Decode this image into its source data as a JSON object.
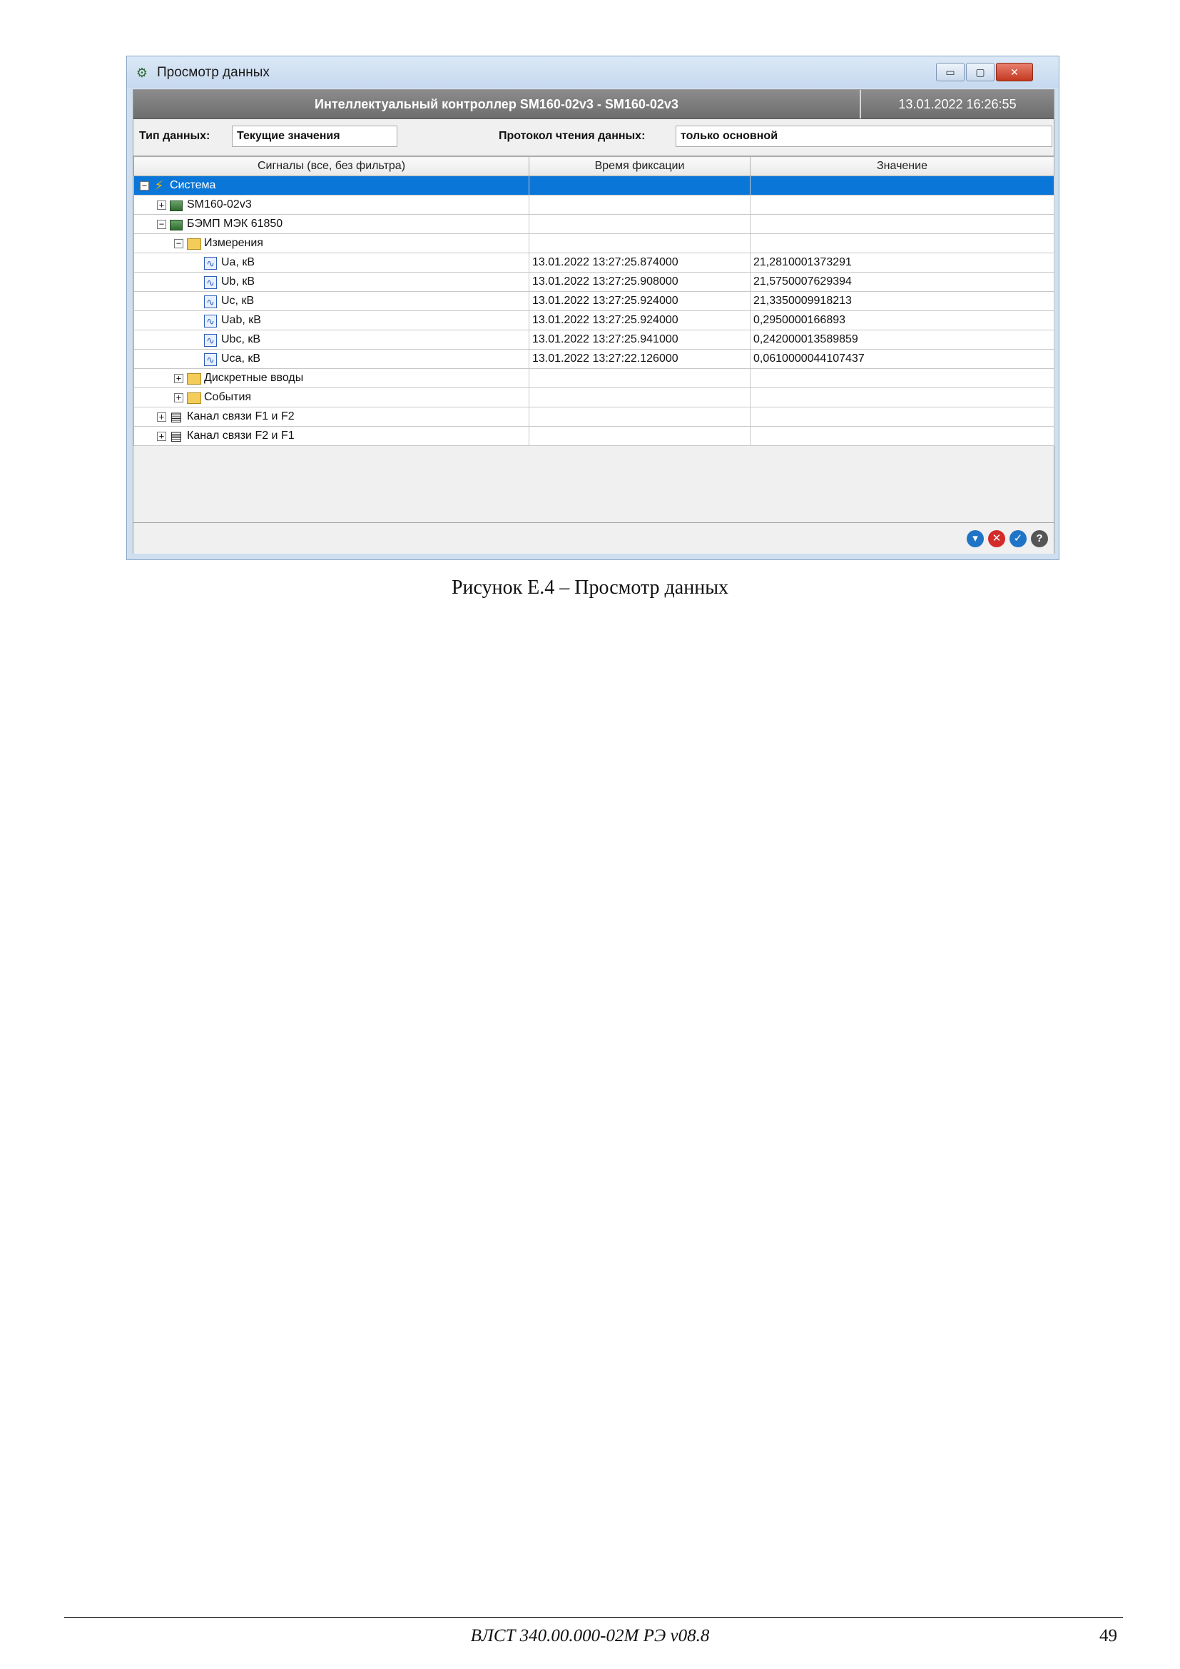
{
  "window": {
    "title": "Просмотр данных",
    "controls": {
      "minimize": "▭",
      "maximize": "▢",
      "close": "✕"
    }
  },
  "header": {
    "title": "Интеллектуальный контроллер SM160-02v3 - SM160-02v3",
    "datetime": "13.01.2022 16:26:55"
  },
  "filters": {
    "data_type_label": "Тип данных:",
    "data_type_value": "Текущие значения",
    "protocol_label": "Протокол чтения данных:",
    "protocol_value": "только основной"
  },
  "grid": {
    "columns": [
      "Сигналы (все, без фильтра)",
      "Время фиксации",
      "Значение"
    ],
    "rows": [
      {
        "name": "Система",
        "icon": "lightning-icon",
        "toggle": "−",
        "time": "",
        "value": ""
      },
      {
        "name": "SM160-02v3",
        "icon": "device-icon",
        "toggle": "+",
        "time": "",
        "value": ""
      },
      {
        "name": "БЭМП МЭК 61850",
        "icon": "device-icon",
        "toggle": "−",
        "time": "",
        "value": ""
      },
      {
        "name": "Измерения",
        "icon": "folder-icon",
        "toggle": "−",
        "time": "",
        "value": ""
      },
      {
        "name": "Ua, кВ",
        "icon": "signal-wave-icon",
        "toggle": "",
        "time": "13.01.2022 13:27:25.874000",
        "value": "21,2810001373291"
      },
      {
        "name": "Ub, кВ",
        "icon": "signal-wave-icon",
        "toggle": "",
        "time": "13.01.2022 13:27:25.908000",
        "value": "21,5750007629394"
      },
      {
        "name": "Uc, кВ",
        "icon": "signal-wave-icon",
        "toggle": "",
        "time": "13.01.2022 13:27:25.924000",
        "value": "21,3350009918213"
      },
      {
        "name": "Uab, кВ",
        "icon": "signal-wave-icon",
        "toggle": "",
        "time": "13.01.2022 13:27:25.924000",
        "value": "0,2950000166893"
      },
      {
        "name": "Ubc, кВ",
        "icon": "signal-wave-icon",
        "toggle": "",
        "time": "13.01.2022 13:27:25.941000",
        "value": "0,242000013589859"
      },
      {
        "name": "Uca, кВ",
        "icon": "signal-wave-icon",
        "toggle": "",
        "time": "13.01.2022 13:27:22.126000",
        "value": "0,0610000044107437"
      },
      {
        "name": "Дискретные вводы",
        "icon": "folder-icon",
        "toggle": "+",
        "time": "",
        "value": ""
      },
      {
        "name": "События",
        "icon": "folder-icon",
        "toggle": "+",
        "time": "",
        "value": ""
      },
      {
        "name": "Канал связи F1 и F2",
        "icon": "channel-icon",
        "toggle": "+",
        "time": "",
        "value": ""
      },
      {
        "name": "Канал связи F2 и F1",
        "icon": "channel-icon",
        "toggle": "+",
        "time": "",
        "value": ""
      }
    ]
  },
  "status_buttons": [
    {
      "name": "filter-icon",
      "glyph": "▾",
      "color": "#1f74c6"
    },
    {
      "name": "cancel-icon",
      "glyph": "✕",
      "color": "#d42a2a"
    },
    {
      "name": "confirm-icon",
      "glyph": "✓",
      "color": "#1f74c6"
    },
    {
      "name": "help-icon",
      "glyph": "?",
      "color": "#555555"
    }
  ],
  "caption": "Рисунок Е.4 – Просмотр данных",
  "footer": {
    "document_code": "ВЛСТ 340.00.000-02М РЭ  v08.8",
    "page_number": "49"
  },
  "colors": {
    "selection": "#0a76d8",
    "header_bar": "#7d7d7d"
  }
}
